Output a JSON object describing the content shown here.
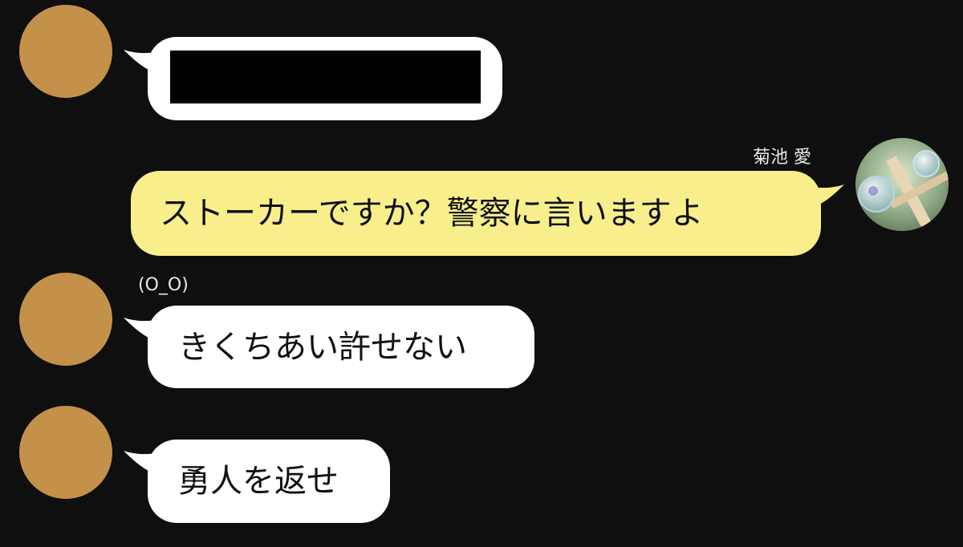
{
  "colors": {
    "background": "#0f0f0f",
    "incoming_bubble": "#ffffff",
    "outgoing_bubble": "#f8ef8c",
    "avatar_placeholder": "#c4914a",
    "redaction": "#000000"
  },
  "messages": [
    {
      "direction": "incoming",
      "sender": "",
      "text": ""
    },
    {
      "direction": "outgoing",
      "sender": "菊池 愛",
      "text": "ストーカーですか？警察に言いますよ"
    },
    {
      "direction": "incoming",
      "sender": "(O_O)",
      "text": "きくちあい許せない"
    },
    {
      "direction": "incoming",
      "sender": "",
      "text": "勇人を返せ"
    }
  ]
}
